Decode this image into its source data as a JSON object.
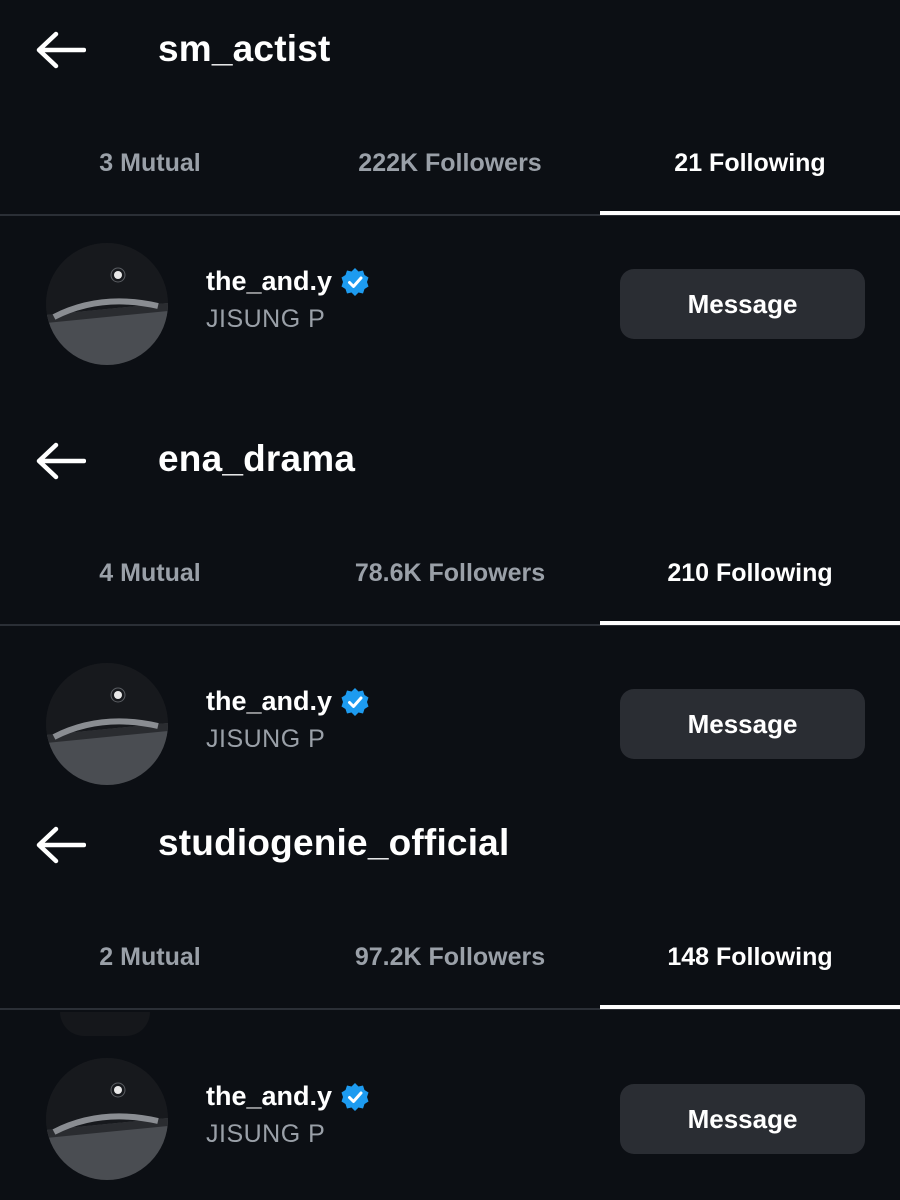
{
  "panels": [
    {
      "title": "sm_actist",
      "tabs": {
        "mutual": "3 Mutual",
        "followers": "222K Followers",
        "following": "21 Following"
      },
      "active_tab": "following",
      "user": {
        "username": "the_and.y",
        "display_name": "JISUNG P",
        "verified": true,
        "button": "Message"
      }
    },
    {
      "title": "ena_drama",
      "tabs": {
        "mutual": "4 Mutual",
        "followers": "78.6K Followers",
        "following": "210 Following"
      },
      "active_tab": "following",
      "user": {
        "username": "the_and.y",
        "display_name": "JISUNG P",
        "verified": true,
        "button": "Message"
      }
    },
    {
      "title": "studiogenie_official",
      "tabs": {
        "mutual": "2 Mutual",
        "followers": "97.2K Followers",
        "following": "148 Following"
      },
      "active_tab": "following",
      "user": {
        "username": "the_and.y",
        "display_name": "JISUNG P",
        "verified": true,
        "button": "Message"
      }
    }
  ],
  "icons": {
    "back": "arrow-left-icon",
    "verified": "verified-badge-icon"
  },
  "colors": {
    "background": "#0c0f14",
    "muted_text": "#9aa0a8",
    "button_bg": "#2a2d33",
    "verified": "#1d9bf0",
    "divider": "#2b2f36"
  }
}
